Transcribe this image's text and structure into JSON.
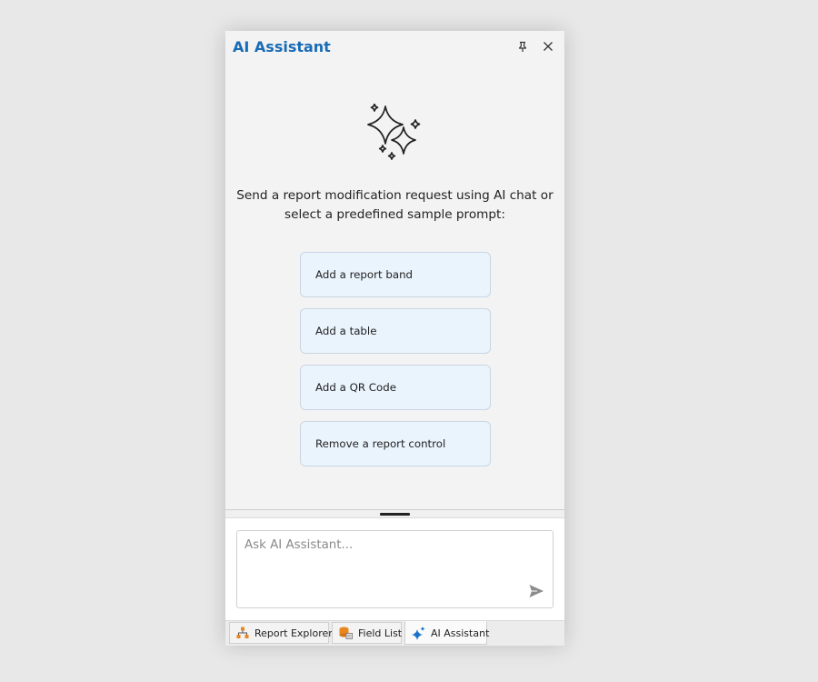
{
  "header": {
    "title": "AI Assistant",
    "pin_icon": "pin-icon",
    "close_icon": "close-icon"
  },
  "main": {
    "icon": "sparkles-icon",
    "intro_line1": "Send a report modification request using AI chat or",
    "intro_line2": "select a predefined sample prompt:",
    "prompts": [
      {
        "label": "Add a report band"
      },
      {
        "label": "Add a table"
      },
      {
        "label": "Add a QR Code"
      },
      {
        "label": "Remove a report control"
      }
    ]
  },
  "chat": {
    "placeholder": "Ask AI Assistant...",
    "value": "",
    "send_icon": "send-icon"
  },
  "tabs": [
    {
      "label": "Report Explorer",
      "icon": "report-explorer-icon",
      "active": false
    },
    {
      "label": "Field List",
      "icon": "field-list-icon",
      "active": false
    },
    {
      "label": "AI Assistant",
      "icon": "ai-sparkle-icon",
      "active": true
    }
  ],
  "colors": {
    "title": "#1a6bb5",
    "prompt_background": "#eaf4fd",
    "prompt_border": "#c9d6e3",
    "orange_icon": "#e8871e",
    "blue_icon": "#1a73c9"
  }
}
